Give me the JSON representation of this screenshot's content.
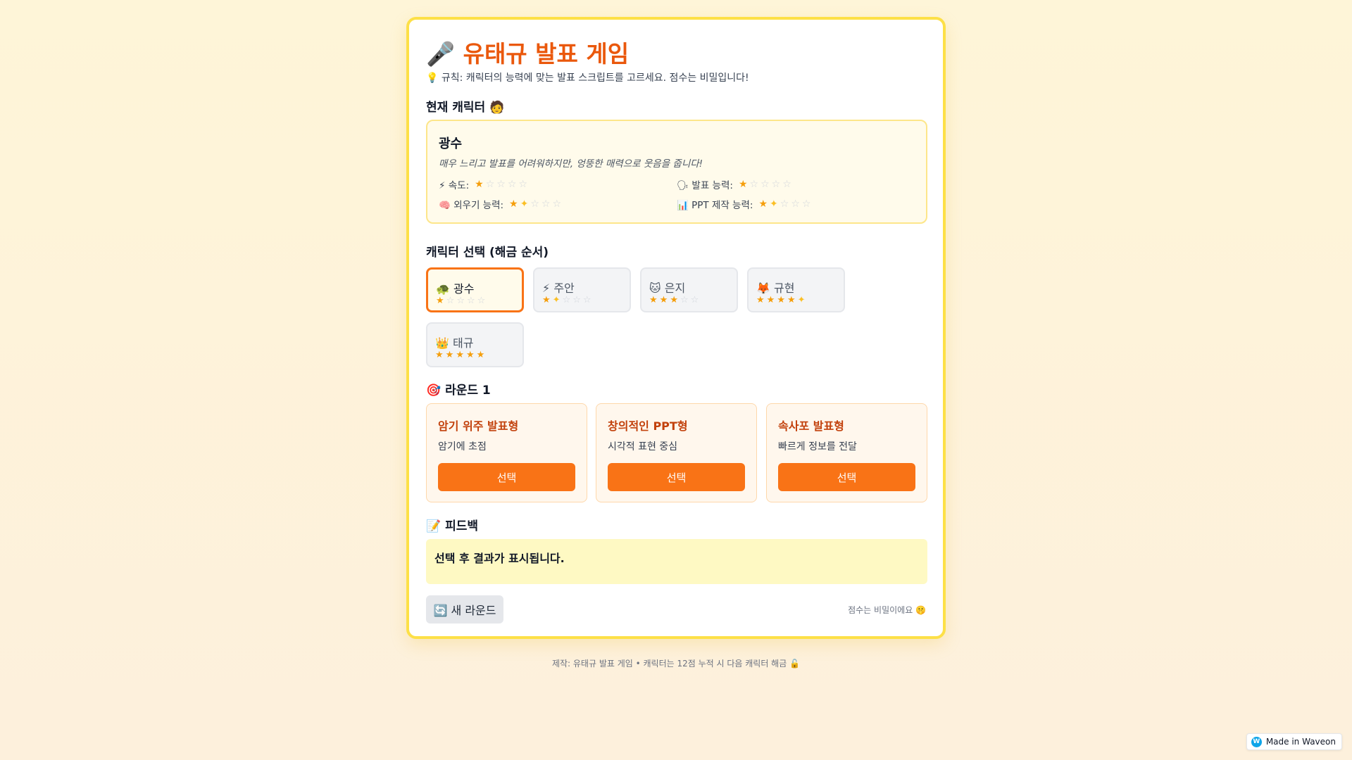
{
  "header": {
    "title": "🎤 유태규 발표 게임",
    "rules": "💡 규칙: 캐릭터의 능력에 맞는 발표 스크립트를 고르세요. 점수는 비밀입니다!"
  },
  "current_character": {
    "heading": "현재 캐릭터 🧑",
    "name": "광수",
    "description": "매우 느리고 발표를 어려워하지만, 엉뚱한 매력으로 웃음을 줍니다!",
    "stats": [
      {
        "label": "⚡ 속도:",
        "rating": 1
      },
      {
        "label": "🗣 발표 능력:",
        "rating": 1
      },
      {
        "label": "🧠 외우기 능력:",
        "rating": 1.5
      },
      {
        "label": "📊 PPT 제작 능력:",
        "rating": 1.5
      }
    ]
  },
  "character_select": {
    "heading": "캐릭터 선택 (해금 순서)",
    "selected": "광수",
    "characters": [
      {
        "label": "🐢 광수",
        "rating": 1
      },
      {
        "label": "⚡ 주안",
        "rating": 1.5
      },
      {
        "label": "🐱 은지",
        "rating": 3
      },
      {
        "label": "🦊 규현",
        "rating": 4.5
      },
      {
        "label": "👑 태규",
        "rating": 5
      }
    ]
  },
  "round": {
    "heading": "🎯 라운드 1",
    "choices": [
      {
        "title": "암기 위주 발표형",
        "desc": "암기에 초점",
        "button": "선택"
      },
      {
        "title": "창의적인 PPT형",
        "desc": "시각적 표현 중심",
        "button": "선택"
      },
      {
        "title": "속사포 발표형",
        "desc": "빠르게 정보를 전달",
        "button": "선택"
      }
    ]
  },
  "feedback": {
    "heading": "📝 피드백",
    "text": "선택 후 결과가 표시됩니다."
  },
  "controls": {
    "new_round": "🔄 새 라운드",
    "secret_note": "점수는 비밀이에요 🤫"
  },
  "footer": "제작: 유태규 발표 게임 • 캐릭터는 12점 누적 시 다음 캐릭터 해금 🔓",
  "badge": "Made in Waveon",
  "colors": {
    "accent": "#f97316",
    "title": "#ea580c",
    "border": "#fde047",
    "star": "#f59e0b"
  }
}
